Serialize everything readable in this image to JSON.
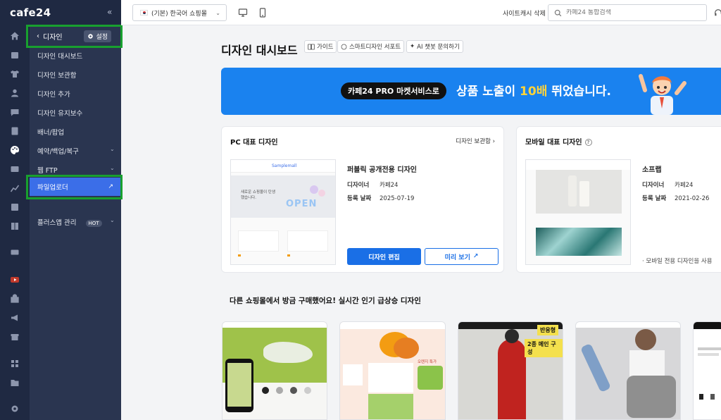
{
  "app": {
    "logo": "cafe24",
    "collapse_glyph": "«"
  },
  "rail": {
    "icons": [
      "home-icon",
      "box-icon",
      "shirt-icon",
      "user-icon",
      "chat-icon",
      "document-icon",
      "palette-icon",
      "card-icon",
      "chart-line-icon",
      "chart-bar-icon",
      "book-icon",
      "coupon-icon",
      "youtube-icon",
      "shop-icon",
      "megaphone-icon",
      "store-icon",
      "apps-icon",
      "folder-icon",
      "gear-icon"
    ]
  },
  "sidebar": {
    "back_glyph": "‹",
    "title": "디자인",
    "settings_label": "설정",
    "items": [
      {
        "label": "디자인 대시보드"
      },
      {
        "label": "디자인 보관함"
      },
      {
        "label": "디자인 추가"
      },
      {
        "label": "디자인 유지보수"
      },
      {
        "label": "배너/팝업"
      },
      {
        "label": "예약/백업/복구",
        "caret": "⌄"
      },
      {
        "label": "웹 FTP",
        "caret": "⌄"
      },
      {
        "label": "파일업로더",
        "ext": "↗"
      },
      {
        "label": "플러스앱 관리",
        "badge": "HOT",
        "caret": "⌄"
      }
    ]
  },
  "header": {
    "mall_select": "(기본) 한국어 쇼핑몰",
    "cache_delete": "사이트캐시 삭제",
    "search_placeholder": "카페24 통합검색"
  },
  "main": {
    "title": "디자인 대시보드",
    "chips": [
      "가이드",
      "스마트디자인 서포트",
      "AI 챗봇 문의하기"
    ],
    "banner": {
      "pill": "카페24 PRO 마켓서비스로",
      "text_a": "상품 노출이 ",
      "text_b": "10배",
      "text_c": " 뛰었습니다."
    },
    "pc_card": {
      "title": "PC 대표 디자인",
      "link": "디자인 보관함 ›",
      "name": "퍼블릭 공개전용 디자인",
      "designer_key": "디자이너",
      "designer_val": "카페24",
      "date_key": "등록 날짜",
      "date_val": "2025-07-19",
      "edit_button": "디자인 편집",
      "preview_button": "미리 보기",
      "thumb_brand": "Samplemall",
      "thumb_text": "새로운 쇼핑몰이 탄생했습니다.",
      "thumb_open": "OPEN"
    },
    "mobile_card": {
      "title": "모바일 대표 디자인",
      "help": "?",
      "name": "소프랩",
      "designer_key": "디자이너",
      "designer_val": "카페24",
      "date_key": "등록 날짜",
      "date_val": "2021-02-26",
      "note": "· 모바일 전용 디자인을 사용"
    },
    "section_title": "다른 쇼핑몰에서 방금 구매했어요! 실시간 인기 급상승 디자인",
    "tiles": [
      {
        "theme": "sneaker"
      },
      {
        "theme": "fruit",
        "label": "오렌지 특가"
      },
      {
        "theme": "fashion-red",
        "badge1": "반응형",
        "badge2": "2종 메인 구성"
      },
      {
        "theme": "fashion-grey"
      },
      {
        "theme": "minimal"
      }
    ]
  },
  "colors": {
    "rail": "#1f2942",
    "sidebar": "#2a3550",
    "active": "#3b6ee8",
    "highlight": "#18a02f",
    "banner": "#1a82ef",
    "primary": "#1a6fe6"
  }
}
